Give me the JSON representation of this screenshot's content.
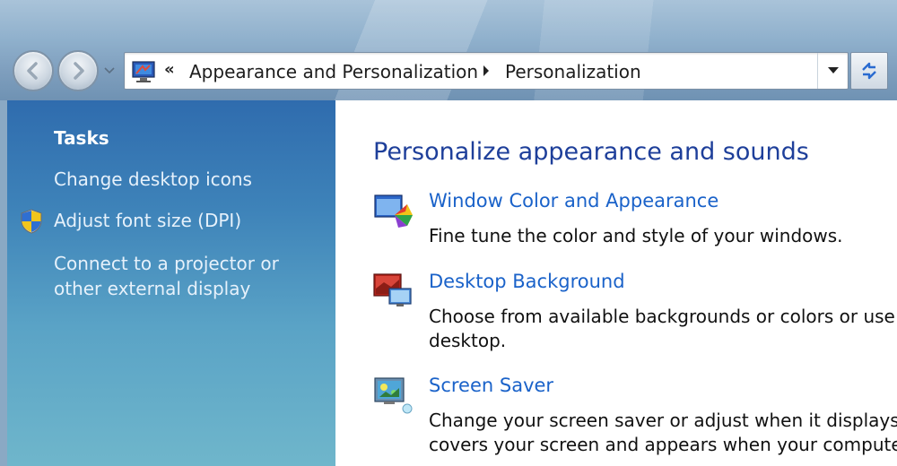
{
  "navigation": {
    "breadcrumb_prefix": "«",
    "breadcrumbs": [
      "Appearance and Personalization",
      "Personalization"
    ]
  },
  "sidebar": {
    "title": "Tasks",
    "items": [
      {
        "label": "Change desktop icons",
        "icon": null
      },
      {
        "label": "Adjust font size (DPI)",
        "icon": "uac-shield-icon"
      },
      {
        "label": "Connect to a projector or other external display",
        "icon": null
      }
    ]
  },
  "main": {
    "title": "Personalize appearance and sounds",
    "items": [
      {
        "label": "Window Color and Appearance",
        "description": "Fine tune the color and style of your windows.",
        "icon": "window-color-icon"
      },
      {
        "label": "Desktop Background",
        "description_lines": [
          "Choose from available backgrounds or colors or use or",
          "desktop."
        ],
        "icon": "desktop-background-icon"
      },
      {
        "label": "Screen Saver",
        "description_lines": [
          "Change your screen saver or adjust when it displays. A",
          "covers your screen and appears when your computer is"
        ],
        "icon": "screen-saver-icon"
      }
    ]
  },
  "colors": {
    "sidebar_top": "#2f6cae",
    "sidebar_bottom": "#6fb6cb",
    "title_blue": "#1e3f9a",
    "link_blue": "#1a62c9"
  }
}
